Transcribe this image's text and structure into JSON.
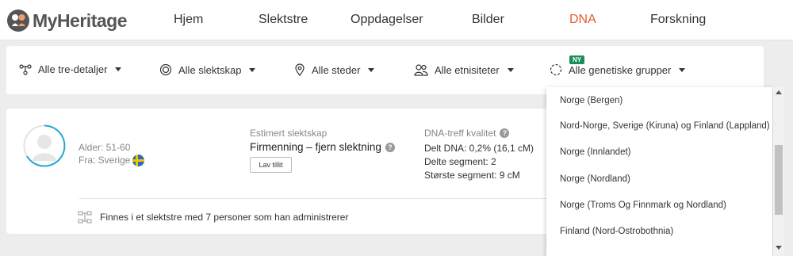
{
  "header": {
    "logo_text": "MyHeritage",
    "nav": [
      {
        "label": "Hjem",
        "active": false
      },
      {
        "label": "Slektstre",
        "active": false
      },
      {
        "label": "Oppdagelser",
        "active": false
      },
      {
        "label": "Bilder",
        "active": false
      },
      {
        "label": "DNA",
        "active": true
      },
      {
        "label": "Forskning",
        "active": false
      }
    ]
  },
  "filters": {
    "tree_details": "Alle tre-detaljer",
    "relationships": "Alle slektskap",
    "places": "Alle steder",
    "ethnicities": "Alle etnisiteter",
    "genetic_groups": "Alle genetiske grupper",
    "new_badge": "NY"
  },
  "match": {
    "age": "Alder: 51-60",
    "from": "Fra: Sverige",
    "estimated_label": "Estimert slektskap",
    "relationship": "Firmenning – fjern slektning",
    "lav_tillit": "Lav tillit",
    "quality_label": "DNA-treff kvalitet",
    "shared_dna": "Delt DNA: 0,2% (16,1 cM)",
    "shared_segments": "Delte segment: 2",
    "largest_segment": "Største segment: 9 cM",
    "tree_info": "Finnes i et slektstre med 7 personer som han administrerer"
  },
  "dropdown": {
    "options": [
      "Norge (Bergen)",
      "Nord-Norge, Sverige (Kiruna) og Finland (Lappland)",
      "Norge (Innlandet)",
      "Norge (Nordland)",
      "Norge (Troms Og Finnmark og Nordland)",
      "Finland (Nord-Ostrobothnia)"
    ]
  },
  "colors": {
    "brand_orange": "#e85d2c",
    "avatar_ring": "#29a7d6",
    "badge_green": "#1b8c5c"
  }
}
